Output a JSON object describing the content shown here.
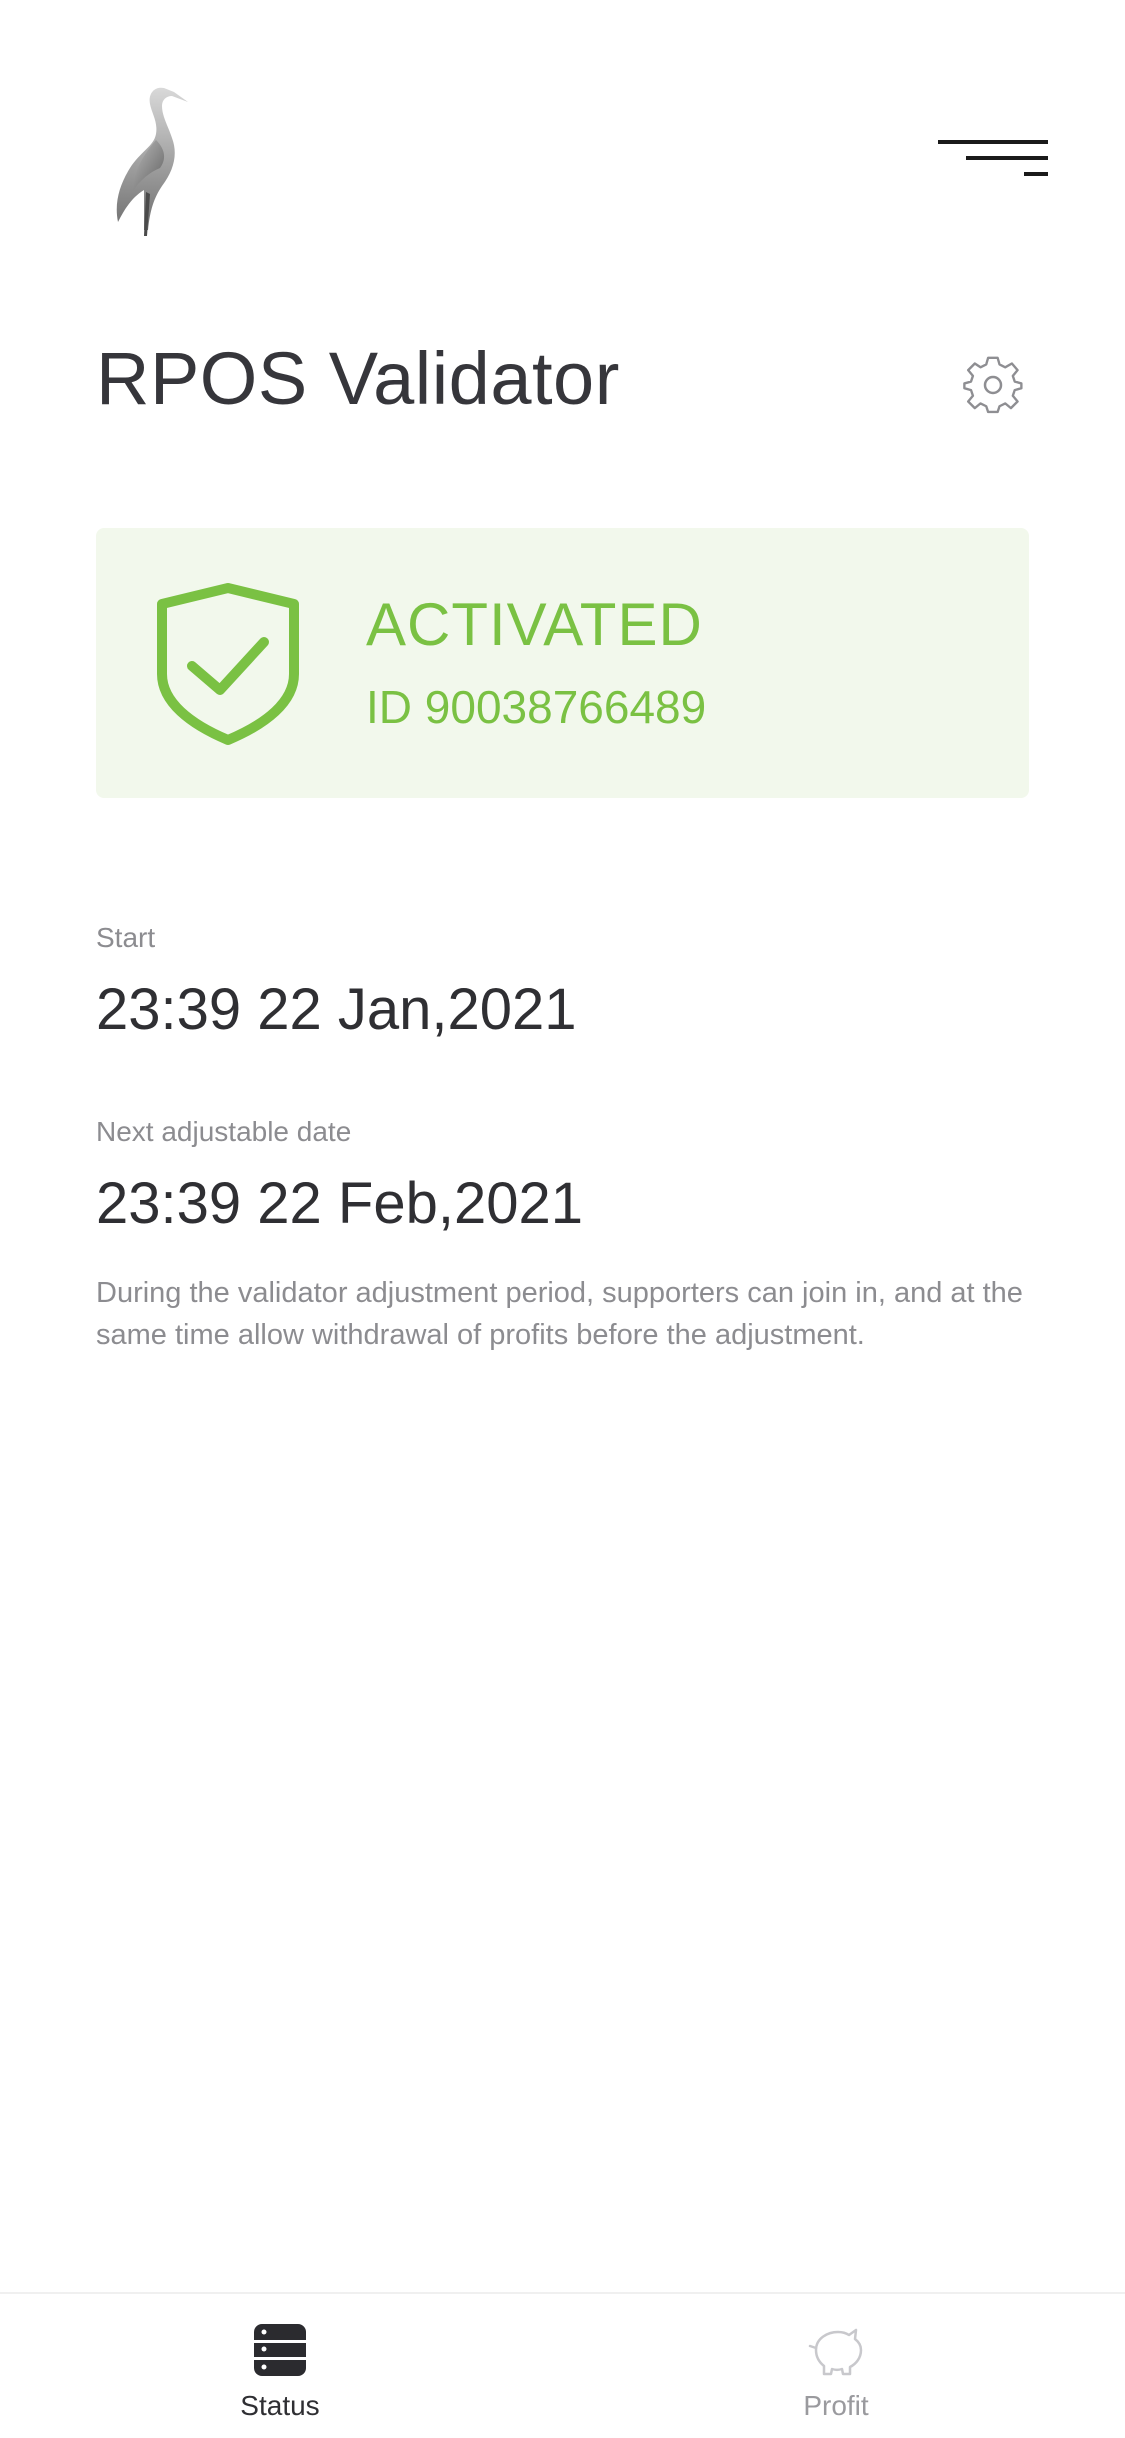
{
  "header": {
    "logo_icon": "crane-bird-logo",
    "menu_icon": "hamburger-menu-icon"
  },
  "page": {
    "title": "RPOS Validator",
    "settings_icon": "gear-icon"
  },
  "status_card": {
    "icon": "shield-check-icon",
    "status": "ACTIVATED",
    "id": "ID 90038766489",
    "accent_color": "#7ac143",
    "background_color": "#f2f8ec"
  },
  "details": {
    "start_label": "Start",
    "start_value": "23:39 22 Jan,2021",
    "next_label": "Next adjustable date",
    "next_value": "23:39 22 Feb,2021",
    "note": "During the validator adjustment period, supporters can join in, and at the same time allow withdrawal of profits before the adjustment."
  },
  "tabbar": {
    "tabs": [
      {
        "label": "Status",
        "icon": "list-icon",
        "active": true
      },
      {
        "label": "Profit",
        "icon": "piggy-bank-icon",
        "active": false
      }
    ]
  }
}
